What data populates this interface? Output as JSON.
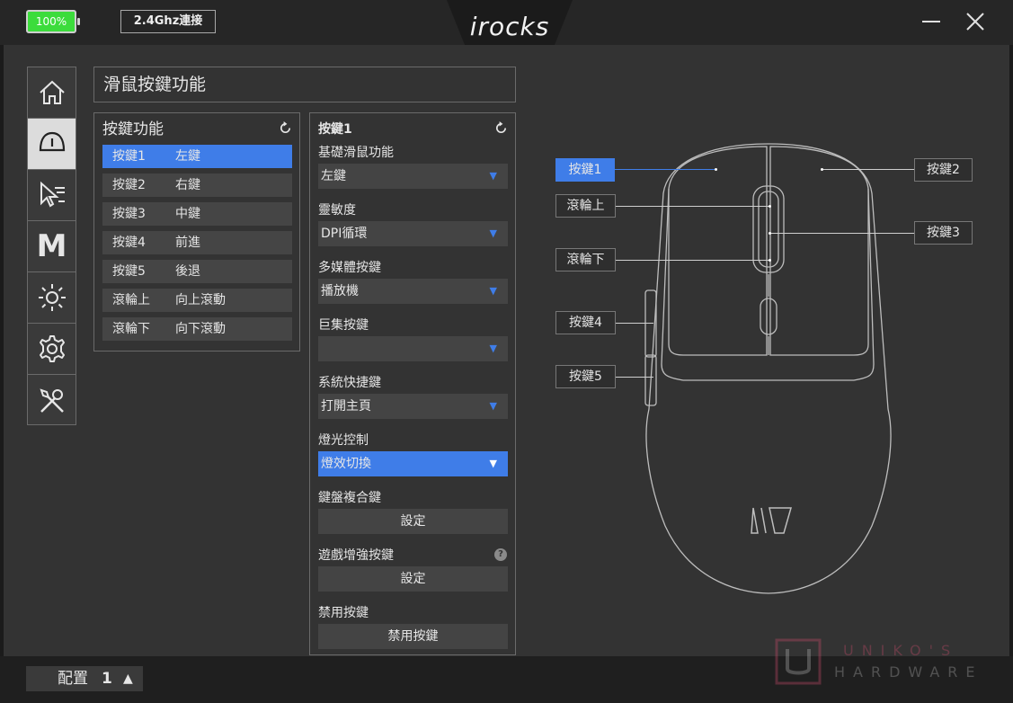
{
  "titlebar": {
    "battery": "100%",
    "connection": "2.4Ghz連接",
    "logo": "irocks",
    "battery_color": "#3cdc3c"
  },
  "sidebar": {
    "items": [
      {
        "name": "home",
        "icon": "home-icon"
      },
      {
        "name": "mouse-buttons",
        "icon": "mouse-icon",
        "active": true
      },
      {
        "name": "pointer",
        "icon": "pointer-speed-icon"
      },
      {
        "name": "macro",
        "icon": "macro-icon",
        "label": "M"
      },
      {
        "name": "lighting",
        "icon": "sun-icon"
      },
      {
        "name": "settings",
        "icon": "gear-icon"
      },
      {
        "name": "tools",
        "icon": "tools-icon"
      }
    ]
  },
  "panel": {
    "title": "滑鼠按鍵功能"
  },
  "key_panel": {
    "title": "按鍵功能",
    "rows": [
      {
        "key": "按鍵1",
        "value": "左鍵"
      },
      {
        "key": "按鍵2",
        "value": "右鍵"
      },
      {
        "key": "按鍵3",
        "value": "中鍵"
      },
      {
        "key": "按鍵4",
        "value": "前進"
      },
      {
        "key": "按鍵5",
        "value": "後退"
      },
      {
        "key": "滾輪上",
        "value": "向上滾動"
      },
      {
        "key": "滾輪下",
        "value": "向下滾動"
      }
    ]
  },
  "func_panel": {
    "title": "按鍵1",
    "basic_label": "基礎滑鼠功能",
    "basic_value": "左鍵",
    "dpi_label": "靈敏度",
    "dpi_value": "DPI循環",
    "media_label": "多媒體按鍵",
    "media_value": "播放機",
    "macro_label": "巨集按鍵",
    "macro_value": "",
    "system_label": "系統快捷鍵",
    "system_value": "打開主頁",
    "light_label": "燈光控制",
    "light_value": "燈效切換",
    "keyboard_label": "鍵盤複合鍵",
    "keyboard_button": "設定",
    "game_label": "遊戲增強按鍵",
    "game_button": "設定",
    "disable_label": "禁用按鍵",
    "disable_button": "禁用按鍵",
    "help": "?"
  },
  "mouse_labels": {
    "b1": "按鍵1",
    "b2": "按鍵2",
    "b3": "按鍵3",
    "b4": "按鍵4",
    "b5": "按鍵5",
    "wheel_up": "滾輪上",
    "wheel_down": "滾輪下"
  },
  "bottom": {
    "profile_label": "配置",
    "profile_num": "1",
    "up_arrow": "▲"
  },
  "watermark": {
    "line1": "UNIKO'S",
    "line2": "HARDWARE"
  },
  "colors": {
    "accent": "#3f7de8"
  }
}
